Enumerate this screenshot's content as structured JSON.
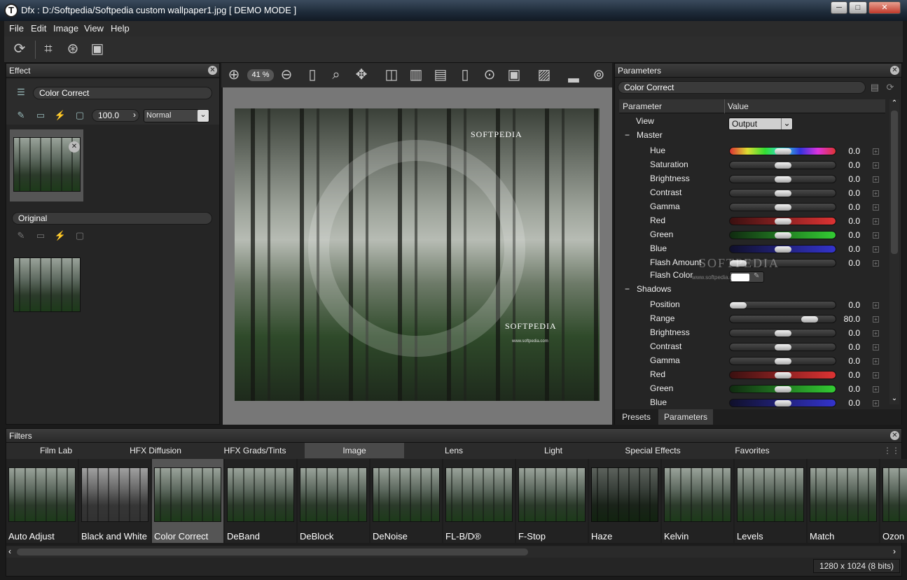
{
  "window": {
    "title": "Dfx : D:/Softpedia/Softpedia custom wallpaper1.jpg [ DEMO MODE ]",
    "minimize": "─",
    "maximize": "□",
    "close": "✕"
  },
  "menu": [
    "File",
    "Edit",
    "Image",
    "View",
    "Help"
  ],
  "effect_panel": {
    "title": "Effect",
    "effect_name": "Color Correct",
    "opacity": "100.0",
    "blend_mode": "Normal",
    "original_label": "Original"
  },
  "viewer": {
    "zoom": "41 %",
    "watermark_top": "SOFTPEDIA",
    "watermark_bottom": "SOFTPEDIA",
    "watermark_url": "www.softpedia.com"
  },
  "parameters_panel": {
    "title": "Parameters",
    "filter_name": "Color Correct",
    "col_param": "Parameter",
    "col_value": "Value",
    "view_label": "View",
    "view_value": "Output",
    "master_label": "Master",
    "shadows_label": "Shadows",
    "master": [
      {
        "name": "Hue",
        "value": "0.0",
        "level": 0.5,
        "track": "hue"
      },
      {
        "name": "Saturation",
        "value": "0.0",
        "level": 0.5,
        "track": "gray"
      },
      {
        "name": "Brightness",
        "value": "0.0",
        "level": 0.5,
        "track": "gray"
      },
      {
        "name": "Contrast",
        "value": "0.0",
        "level": 0.5,
        "track": "gray"
      },
      {
        "name": "Gamma",
        "value": "0.0",
        "level": 0.5,
        "track": "gray"
      },
      {
        "name": "Red",
        "value": "0.0",
        "level": 0.5,
        "track": "red"
      },
      {
        "name": "Green",
        "value": "0.0",
        "level": 0.5,
        "track": "green"
      },
      {
        "name": "Blue",
        "value": "0.0",
        "level": 0.5,
        "track": "blue"
      },
      {
        "name": "Flash Amount",
        "value": "0.0",
        "level": 0.0,
        "track": "gray"
      }
    ],
    "flash_color_label": "Flash Color",
    "shadows": [
      {
        "name": "Position",
        "value": "0.0",
        "level": 0.0,
        "track": "gray"
      },
      {
        "name": "Range",
        "value": "80.0",
        "level": 0.8,
        "track": "gray"
      },
      {
        "name": "Brightness",
        "value": "0.0",
        "level": 0.5,
        "track": "gray"
      },
      {
        "name": "Contrast",
        "value": "0.0",
        "level": 0.5,
        "track": "gray"
      },
      {
        "name": "Gamma",
        "value": "0.0",
        "level": 0.5,
        "track": "gray"
      },
      {
        "name": "Red",
        "value": "0.0",
        "level": 0.5,
        "track": "red"
      },
      {
        "name": "Green",
        "value": "0.0",
        "level": 0.5,
        "track": "green"
      },
      {
        "name": "Blue",
        "value": "0.0",
        "level": 0.5,
        "track": "blue"
      }
    ],
    "tabs": [
      "Presets",
      "Parameters"
    ],
    "softpedia_overlay": "SOFTPEDIA",
    "softpedia_url": "www.softpedia.com"
  },
  "filters_panel": {
    "title": "Filters",
    "tabs": [
      "Film Lab",
      "HFX Diffusion",
      "HFX Grads/Tints",
      "Image",
      "Lens",
      "Light",
      "Special Effects",
      "Favorites"
    ],
    "active_tab": "Image",
    "items": [
      "Auto Adjust",
      "Black and White",
      "Color Correct",
      "DeBand",
      "DeBlock",
      "DeNoise",
      "FL-B/D®",
      "F-Stop",
      "Haze",
      "Kelvin",
      "Levels",
      "Match",
      "Ozon"
    ]
  },
  "status": {
    "image_info": "1280 x 1024 (8 bits)"
  },
  "colors": {
    "accent": "#4a4a4a",
    "background": "#252525"
  }
}
